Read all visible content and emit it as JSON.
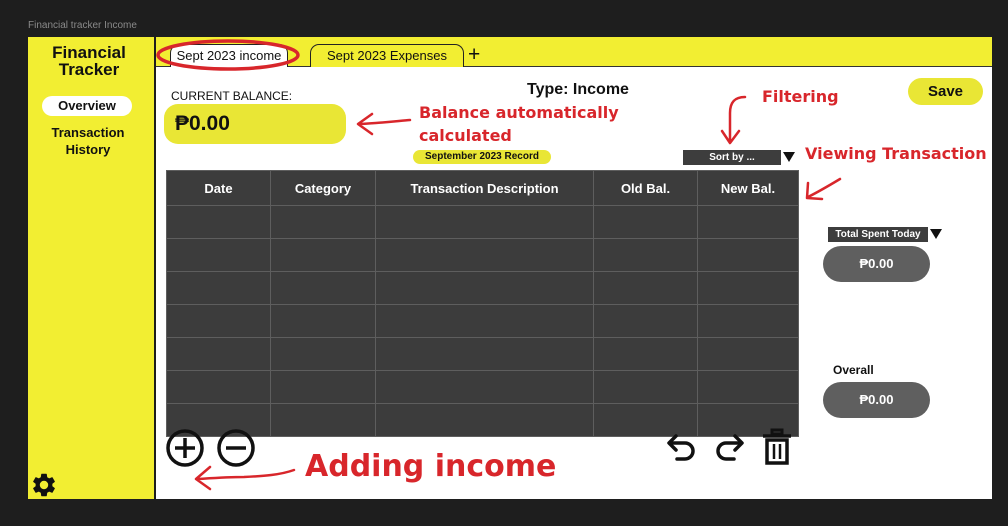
{
  "frame_label": "Financial tracker Income",
  "sidebar": {
    "title": "Financial Tracker",
    "nav": [
      {
        "label": "Overview",
        "active": true
      },
      {
        "label": "Transaction History",
        "active": false
      }
    ],
    "settings_icon": "gear-icon"
  },
  "tabs": [
    {
      "label": "Sept 2023 income",
      "active": true
    },
    {
      "label": "Sept 2023 Expenses",
      "active": false
    }
  ],
  "add_tab_label": "+",
  "header": {
    "type_title": "Type: Income",
    "save_label": "Save"
  },
  "balance": {
    "label": "CURRENT BALANCE:",
    "value": "₱0.00"
  },
  "record_badge": "September 2023 Record",
  "sort": {
    "label": "Sort by ..."
  },
  "table": {
    "columns": [
      "Date",
      "Category",
      "Transaction Description",
      "Old Bal.",
      "New Bal."
    ],
    "rows": [
      [
        "",
        "",
        "",
        "",
        ""
      ],
      [
        "",
        "",
        "",
        "",
        ""
      ],
      [
        "",
        "",
        "",
        "",
        ""
      ],
      [
        "",
        "",
        "",
        "",
        ""
      ],
      [
        "",
        "",
        "",
        "",
        ""
      ],
      [
        "",
        "",
        "",
        "",
        ""
      ],
      [
        "",
        "",
        "",
        "",
        ""
      ]
    ]
  },
  "summary": {
    "spent_today_label": "Total Spent Today",
    "spent_today_value": "₱0.00",
    "overall_label": "Overall",
    "overall_value": "₱0.00"
  },
  "controls": {
    "add_icon": "plus-circle-icon",
    "remove_icon": "minus-circle-icon",
    "undo_icon": "undo-icon",
    "redo_icon": "redo-icon",
    "delete_icon": "trash-icon"
  },
  "annotations": {
    "balance_line1": "Balance automatically",
    "balance_line2": "calculated",
    "filtering": "Filtering",
    "viewing": "Viewing Transaction",
    "adding": "Adding income"
  },
  "colors": {
    "brand_yellow": "#f2ee32",
    "accent_yellow": "#e9e635",
    "table_dark": "#3c3c3c",
    "pill_gray": "#5f5f5f",
    "annotation_red": "#d8262b",
    "canvas_bg": "#1e1e1e"
  }
}
